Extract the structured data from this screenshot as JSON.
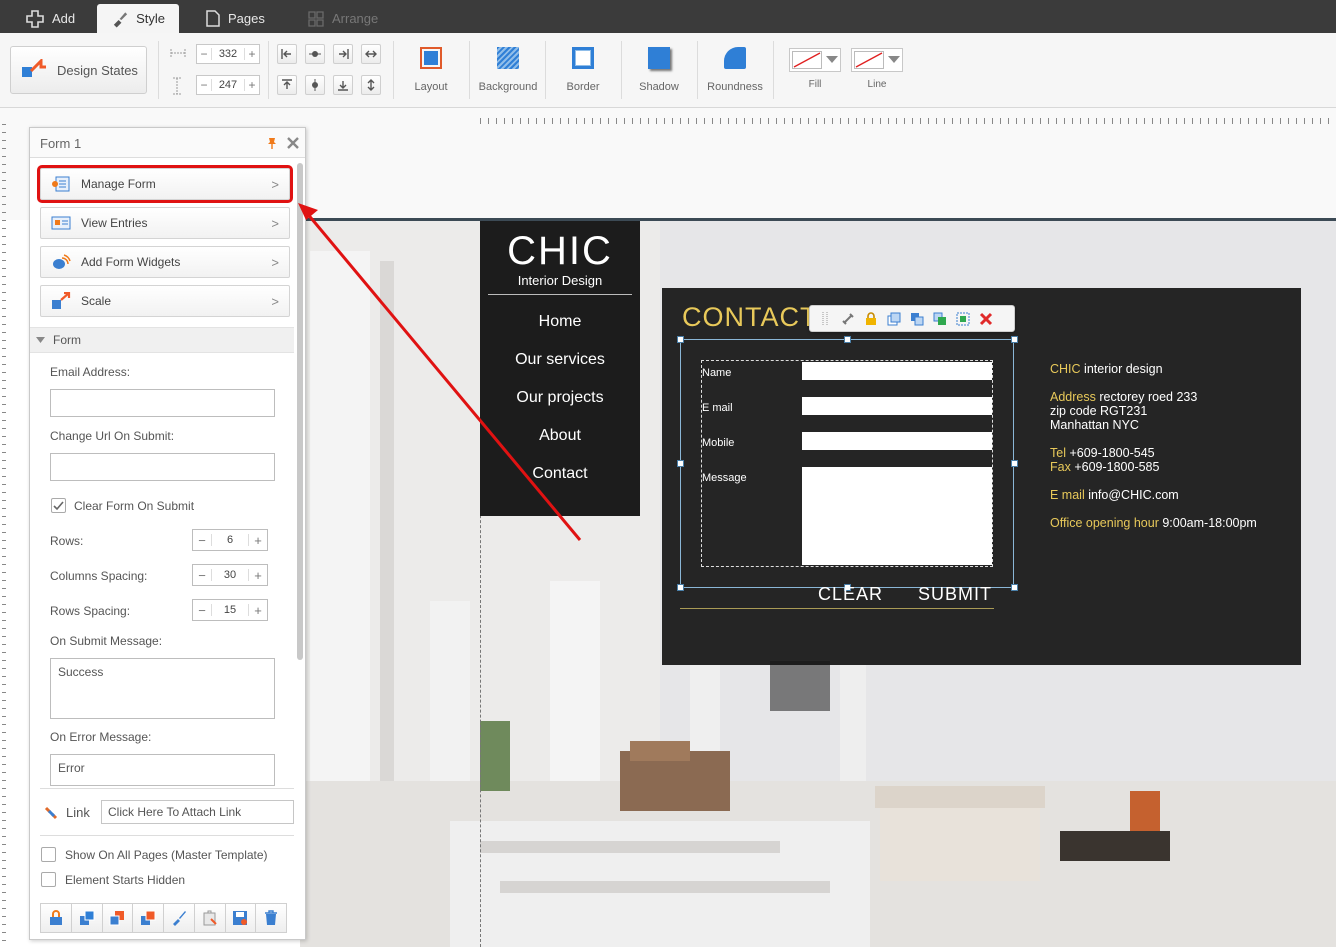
{
  "topbar": {
    "tabs": [
      {
        "label": "Add",
        "icon": "plus-icon"
      },
      {
        "label": "Style",
        "icon": "brush-icon"
      },
      {
        "label": "Pages",
        "icon": "page-icon"
      },
      {
        "label": "Arrange",
        "icon": "grid-icon"
      }
    ]
  },
  "toolbar": {
    "design_states": "Design States",
    "width_value": "332",
    "height_value": "247",
    "tools": [
      "Layout",
      "Background",
      "Border",
      "Shadow",
      "Roundness"
    ],
    "fill_label": "Fill",
    "line_label": "Line"
  },
  "panel": {
    "title": "Form 1",
    "menu": [
      "Manage Form",
      "View Entries",
      "Add Form Widgets",
      "Scale"
    ],
    "section": "Form",
    "email_label": "Email Address:",
    "email_value": "",
    "url_label": "Change Url On Submit:",
    "url_value": "",
    "clear_form_label": "Clear Form On Submit",
    "clear_form_checked": true,
    "rows_label": "Rows:",
    "rows_value": "6",
    "col_spacing_label": "Columns Spacing:",
    "col_spacing_value": "30",
    "row_spacing_label": "Rows Spacing:",
    "row_spacing_value": "15",
    "submit_msg_label": "On Submit Message:",
    "submit_msg_value": "Success",
    "error_msg_label": "On Error Message:",
    "error_msg_value": "Error",
    "link_label": "Link",
    "link_placeholder": "Click Here To Attach Link",
    "master_label": "Show On All Pages (Master Template)",
    "hidden_label": "Element Starts Hidden"
  },
  "site": {
    "logo": "CHIC",
    "tagline": "Interior Design",
    "nav": [
      "Home",
      "Our services",
      "Our projects",
      "About",
      "Contact"
    ]
  },
  "contact": {
    "title": "CONTACT",
    "fields": [
      "Name",
      "E mail",
      "Mobile",
      "Message"
    ],
    "clear_btn": "CLEAR",
    "submit_btn": "SUBMIT",
    "info": {
      "company_hl": "CHIC",
      "company_rest": " interior design",
      "address_hl": "Address",
      "address_line1": " rectorey roed 233",
      "address_line2": "zip code RGT231",
      "address_line3": "Manhattan NYC",
      "tel_hl": "Tel",
      "tel_val": " +609-1800-545",
      "fax_hl": "Fax",
      "fax_val": " +609-1800-585",
      "email_hl": "E mail",
      "email_val": " info@CHIC.com",
      "hours_hl": "Office opening hour",
      "hours_val": " 9:00am-18:00pm"
    }
  },
  "colors": {
    "accent_gold": "#e8c95a",
    "highlight_red": "#e01212",
    "dark_bg": "#1c1c1c",
    "topbar": "#3b3b3b"
  }
}
